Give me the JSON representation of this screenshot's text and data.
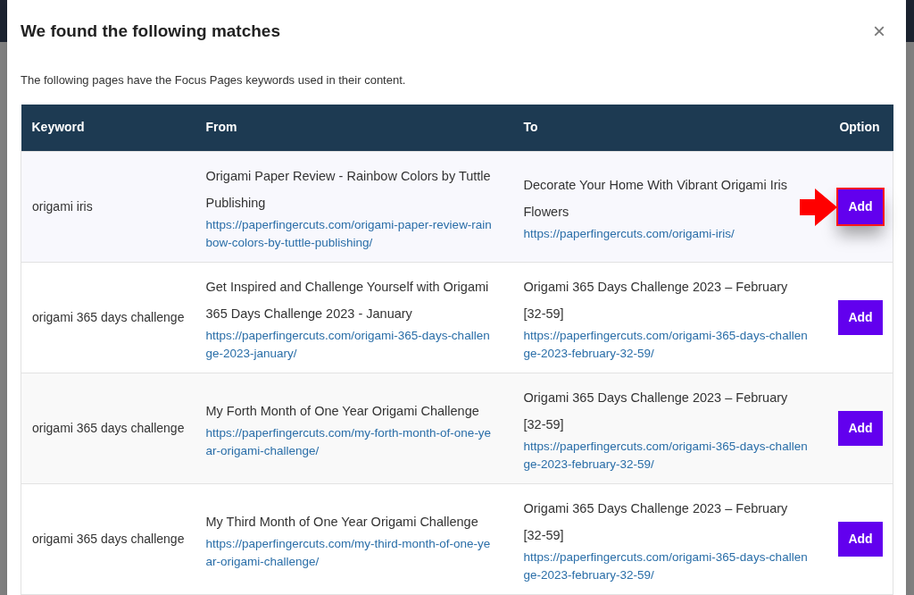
{
  "dialog": {
    "title": "We found the following matches",
    "close": "×",
    "intro": "The following pages have the Focus Pages keywords used in their content."
  },
  "table": {
    "columns": [
      "Keyword",
      "From",
      "To",
      "Option"
    ],
    "rows": [
      {
        "keyword": "origami iris",
        "from_title": "Origami Paper Review - Rainbow Colors by Tuttle Publishing",
        "from_url": "https://paperfingercuts.com/origami-paper-review-rainbow-colors-by-tuttle-publishing/",
        "to_title": "Decorate Your Home With Vibrant Origami Iris Flowers",
        "to_url": "https://paperfingercuts.com/origami-iris/",
        "action": "Add",
        "highlighted": true
      },
      {
        "keyword": "origami 365 days challenge",
        "from_title": "Get Inspired and Challenge Yourself with Origami 365 Days Challenge 2023 - January",
        "from_url": "https://paperfingercuts.com/origami-365-days-challenge-2023-january/",
        "to_title": "Origami 365 Days Challenge 2023 – February [32-59]",
        "to_url": "https://paperfingercuts.com/origami-365-days-challenge-2023-february-32-59/",
        "action": "Add",
        "highlighted": false
      },
      {
        "keyword": "origami 365 days challenge",
        "from_title": "My Forth Month of One Year Origami Challenge",
        "from_url": "https://paperfingercuts.com/my-forth-month-of-one-year-origami-challenge/",
        "to_title": "Origami 365 Days Challenge 2023 – February [32-59]",
        "to_url": "https://paperfingercuts.com/origami-365-days-challenge-2023-february-32-59/",
        "action": "Add",
        "highlighted": false
      },
      {
        "keyword": "origami 365 days challenge",
        "from_title": "My Third Month of One Year Origami Challenge",
        "from_url": "https://paperfingercuts.com/my-third-month-of-one-year-origami-challenge/",
        "to_title": "Origami 365 Days Challenge 2023 – February [32-59]",
        "to_url": "https://paperfingercuts.com/origami-365-days-challenge-2023-february-32-59/",
        "action": "Add",
        "highlighted": false
      }
    ]
  }
}
